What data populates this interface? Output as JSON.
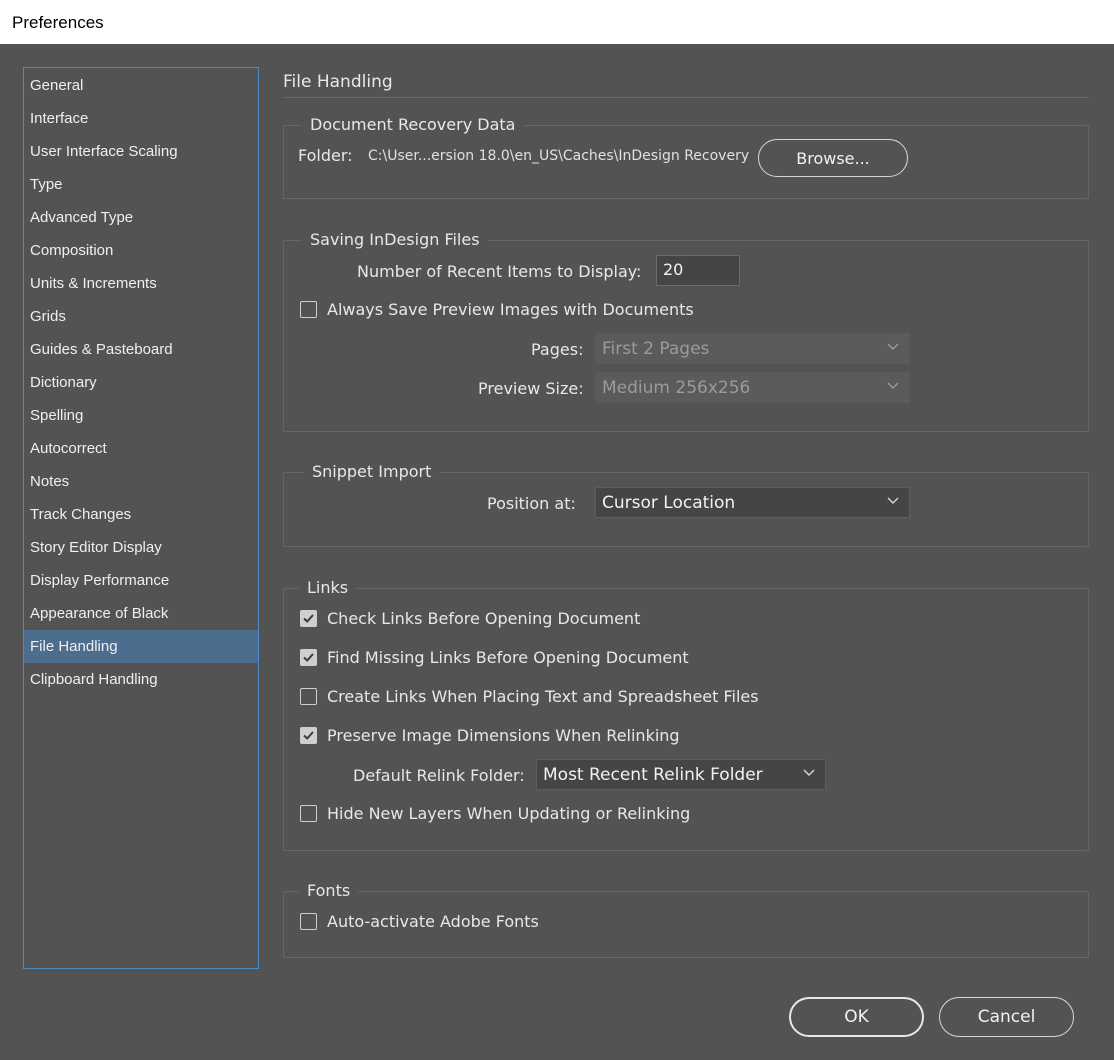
{
  "window": {
    "title": "Preferences"
  },
  "sidebar": {
    "items": [
      {
        "label": "General"
      },
      {
        "label": "Interface"
      },
      {
        "label": "User Interface Scaling"
      },
      {
        "label": "Type"
      },
      {
        "label": "Advanced Type"
      },
      {
        "label": "Composition"
      },
      {
        "label": "Units & Increments"
      },
      {
        "label": "Grids"
      },
      {
        "label": "Guides & Pasteboard"
      },
      {
        "label": "Dictionary"
      },
      {
        "label": "Spelling"
      },
      {
        "label": "Autocorrect"
      },
      {
        "label": "Notes"
      },
      {
        "label": "Track Changes"
      },
      {
        "label": "Story Editor Display"
      },
      {
        "label": "Display Performance"
      },
      {
        "label": "Appearance of Black"
      },
      {
        "label": "File Handling"
      },
      {
        "label": "Clipboard Handling"
      }
    ],
    "selected": "File Handling"
  },
  "page": {
    "title": "File Handling"
  },
  "recovery": {
    "legend": "Document Recovery Data",
    "folder_label": "Folder:",
    "folder_path": "C:\\User...ersion 18.0\\en_US\\Caches\\InDesign Recovery",
    "browse_label": "Browse..."
  },
  "saving": {
    "legend": "Saving InDesign Files",
    "recent_label": "Number of Recent Items to Display:",
    "recent_value": "20",
    "preview_checkbox_label": "Always Save Preview Images with Documents",
    "preview_checked": false,
    "pages_label": "Pages:",
    "pages_value": "First 2 Pages",
    "preview_size_label": "Preview Size:",
    "preview_size_value": "Medium 256x256"
  },
  "snippet": {
    "legend": "Snippet Import",
    "position_label": "Position at:",
    "position_value": "Cursor Location"
  },
  "links": {
    "legend": "Links",
    "check_links_label": "Check Links Before Opening Document",
    "check_links_checked": true,
    "find_missing_label": "Find Missing Links Before Opening Document",
    "find_missing_checked": true,
    "create_links_label": "Create Links When Placing Text and Spreadsheet Files",
    "create_links_checked": false,
    "preserve_dims_label": "Preserve Image Dimensions When Relinking",
    "preserve_dims_checked": true,
    "relink_folder_label": "Default Relink Folder:",
    "relink_folder_value": "Most Recent Relink Folder",
    "hide_layers_label": "Hide New Layers When Updating or Relinking",
    "hide_layers_checked": false
  },
  "fonts": {
    "legend": "Fonts",
    "auto_activate_label": "Auto-activate Adobe Fonts",
    "auto_activate_checked": false
  },
  "buttons": {
    "ok": "OK",
    "cancel": "Cancel"
  },
  "colors": {
    "background": "#535353",
    "selection": "#4d6d8f",
    "sidebar_border": "#4b8bc7"
  }
}
